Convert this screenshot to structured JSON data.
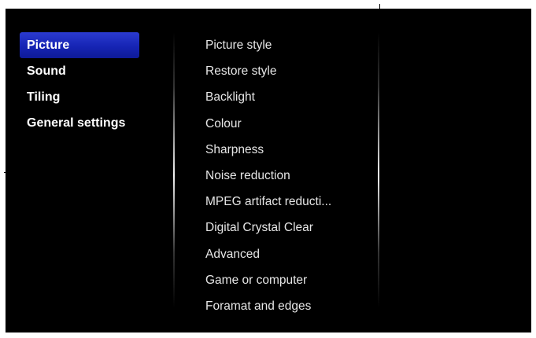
{
  "main_menu": {
    "items": [
      {
        "label": "Picture",
        "selected": true
      },
      {
        "label": "Sound",
        "selected": false
      },
      {
        "label": "Tiling",
        "selected": false
      },
      {
        "label": "General settings",
        "selected": false
      }
    ]
  },
  "sub_menu": {
    "items": [
      {
        "label": "Picture style"
      },
      {
        "label": "Restore style"
      },
      {
        "label": "Backlight"
      },
      {
        "label": "Colour"
      },
      {
        "label": "Sharpness"
      },
      {
        "label": "Noise reduction"
      },
      {
        "label": "MPEG artifact reducti..."
      },
      {
        "label": "Digital Crystal Clear"
      },
      {
        "label": "Advanced"
      },
      {
        "label": "Game or computer"
      },
      {
        "label": "Foramat and edges"
      }
    ]
  },
  "colors": {
    "background": "#000000",
    "selection": "#1f2ec4",
    "text": "#ffffff"
  }
}
